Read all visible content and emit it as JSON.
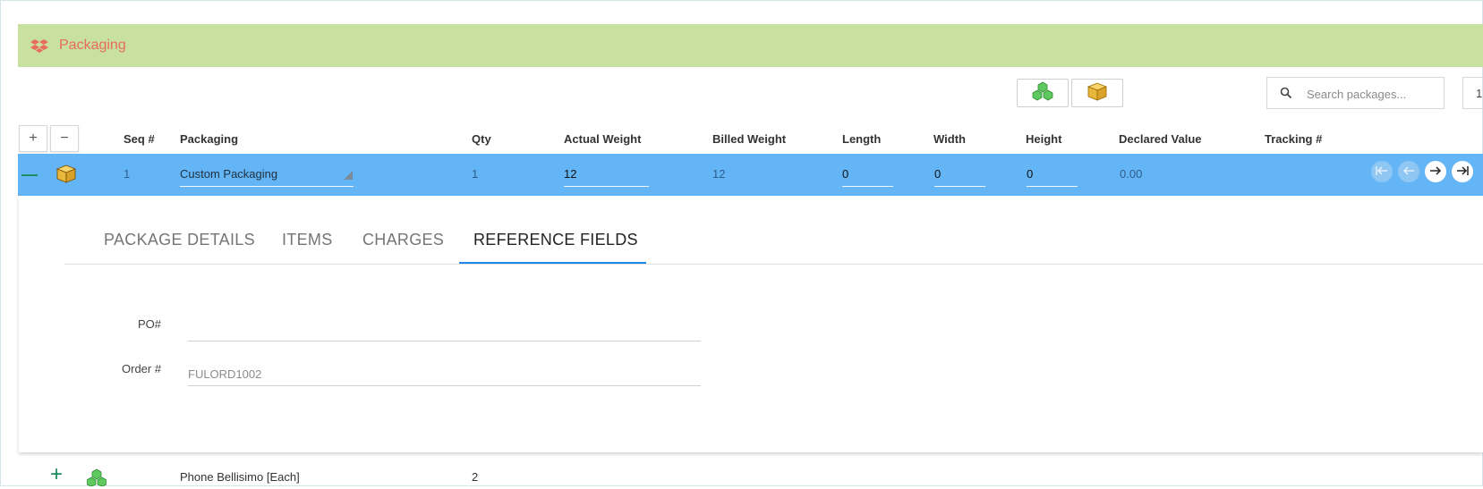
{
  "section": {
    "title": "Packaging",
    "icon": "dropbox-icon"
  },
  "toolbar": {
    "search_placeholder": "Search packages...",
    "page_value": "1",
    "add_label": "+",
    "remove_label": "−"
  },
  "columns": {
    "seq": "Seq #",
    "packaging": "Packaging",
    "qty": "Qty",
    "actual_weight": "Actual Weight",
    "billed_weight": "Billed Weight",
    "length": "Length",
    "width": "Width",
    "height": "Height",
    "declared_value": "Declared Value",
    "tracking": "Tracking #"
  },
  "selected_row": {
    "collapse_label": "—",
    "seq": "1",
    "packaging": "Custom Packaging",
    "qty": "1",
    "actual_weight": "12",
    "billed_weight": "12",
    "length": "0",
    "width": "0",
    "height": "0",
    "declared_value": "0.00"
  },
  "tabs": [
    {
      "label": "PACKAGE DETAILS"
    },
    {
      "label": "ITEMS"
    },
    {
      "label": "CHARGES"
    },
    {
      "label": "REFERENCE FIELDS",
      "active": true
    }
  ],
  "reference_fields": {
    "po_label": "PO#",
    "po_value": "",
    "order_label": "Order #",
    "order_placeholder": "FULORD1002"
  },
  "next_row": {
    "expand_label": "+",
    "name": "Phone Bellisimo [Each]",
    "qty": "2"
  },
  "colors": {
    "header_bg": "#c8e0a0",
    "header_text": "#e96b5b",
    "selected_row": "#64b5f6",
    "tab_indicator": "#1e88e5"
  }
}
